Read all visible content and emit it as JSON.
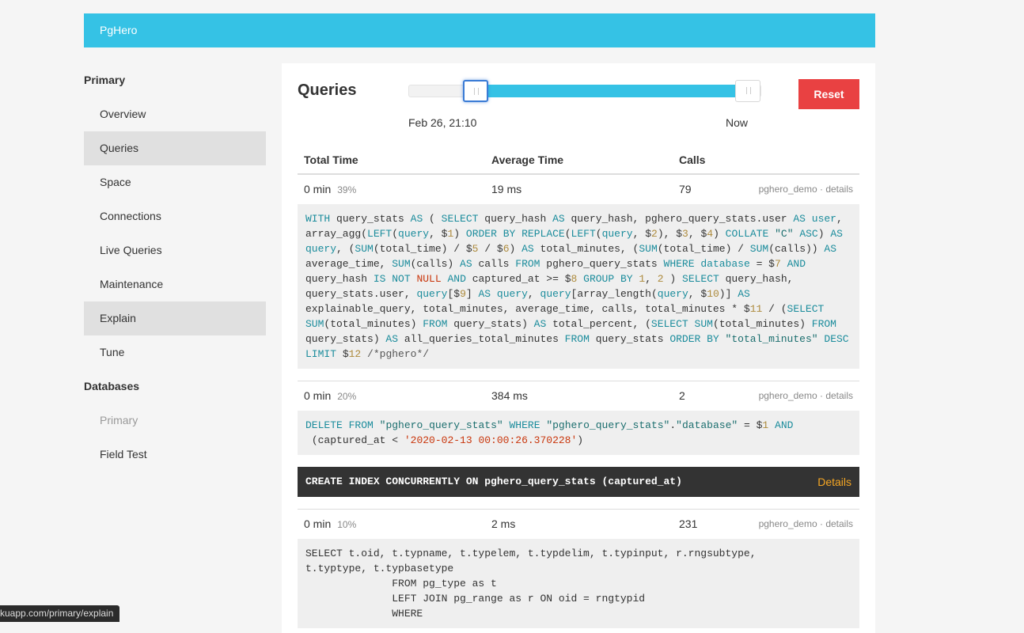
{
  "app": {
    "title": "PgHero"
  },
  "sidebar": {
    "sections": [
      {
        "heading": "Primary",
        "items": [
          {
            "label": "Overview"
          },
          {
            "label": "Queries"
          },
          {
            "label": "Space"
          },
          {
            "label": "Connections"
          },
          {
            "label": "Live Queries"
          },
          {
            "label": "Maintenance"
          },
          {
            "label": "Explain"
          },
          {
            "label": "Tune"
          }
        ]
      },
      {
        "heading": "Databases",
        "items": [
          {
            "label": "Primary"
          },
          {
            "label": "Field Test"
          }
        ]
      }
    ]
  },
  "page": {
    "title": "Queries",
    "slider": {
      "from_label": "Feb 26, 21:10",
      "to_label": "Now"
    },
    "reset_label": "Reset"
  },
  "table": {
    "headers": [
      "Total Time",
      "Average Time",
      "Calls"
    ],
    "rows": [
      {
        "total": "0 min",
        "percent": "39%",
        "avg": "19 ms",
        "calls": "79",
        "db": "pghero_demo",
        "details": "details"
      },
      {
        "total": "0 min",
        "percent": "20%",
        "avg": "384 ms",
        "calls": "2",
        "db": "pghero_demo",
        "details": "details"
      },
      {
        "total": "0 min",
        "percent": "10%",
        "avg": "2 ms",
        "calls": "231",
        "db": "pghero_demo",
        "details": "details"
      }
    ],
    "meta_sep": " · "
  },
  "suggestion": {
    "sql": "CREATE INDEX CONCURRENTLY ON pghero_query_stats (captured_at)",
    "details_label": "Details"
  },
  "query3_text": "SELECT t.oid, t.typname, t.typelem, t.typdelim, t.typinput, r.rngsubtype,\nt.typtype, t.typbasetype\n              FROM pg_type as t\n              LEFT JOIN pg_range as r ON oid = rngtypid\n              WHERE",
  "status_url": "kuapp.com/primary/explain",
  "colors": {
    "accent": "#35c2e5",
    "reset": "#e94142",
    "details": "#f5a623"
  }
}
